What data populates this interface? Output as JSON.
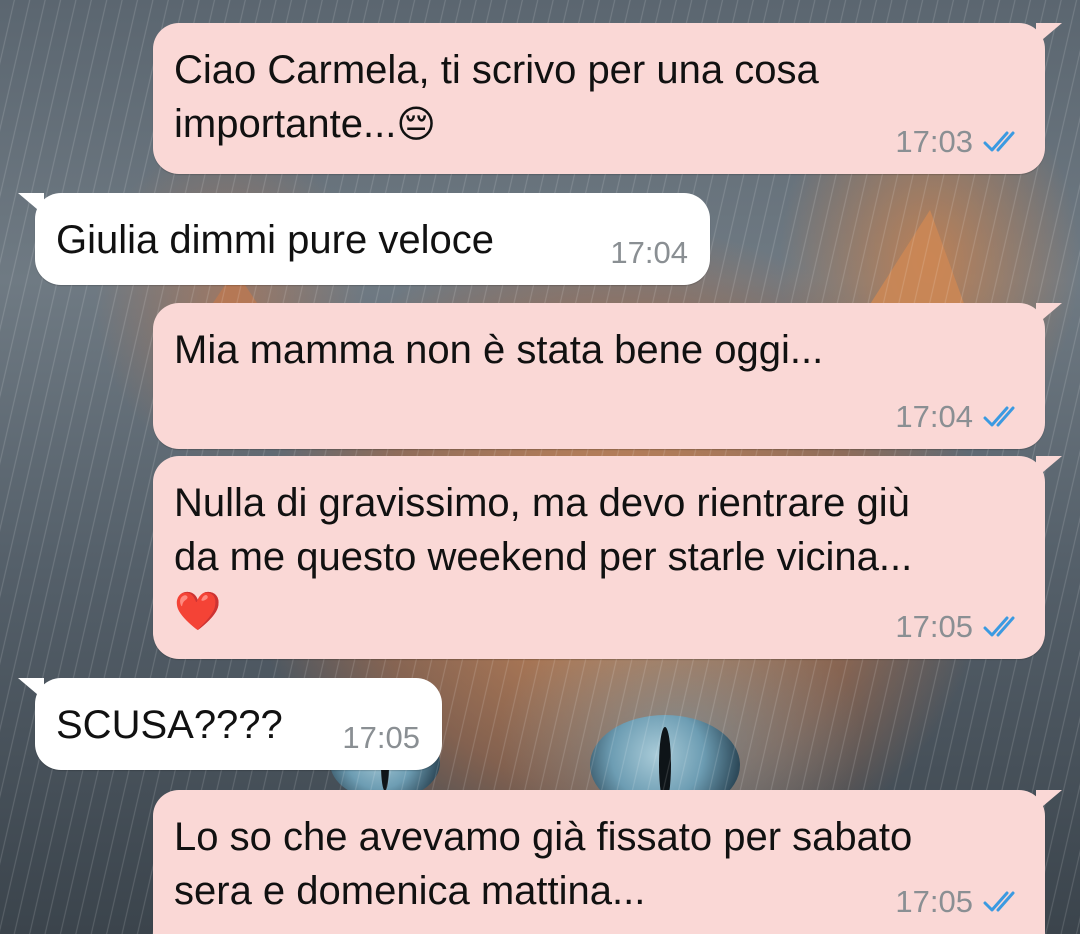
{
  "colors": {
    "outgoing_bubble": "#fad8d6",
    "incoming_bubble": "#ffffff",
    "read_ticks": "#3b9ae1",
    "timestamp": "#8a8f93"
  },
  "messages": [
    {
      "direction": "out",
      "text": "Ciao Carmela, ti scrivo per una cosa\nimportante...",
      "emoji": "😔",
      "time": "17:03",
      "status_icon": "double-check-read-icon"
    },
    {
      "direction": "in",
      "text": "Giulia dimmi pure veloce",
      "time": "17:04"
    },
    {
      "direction": "out",
      "text": "Mia mamma non è stata bene oggi...",
      "time": "17:04",
      "status_icon": "double-check-read-icon"
    },
    {
      "direction": "out",
      "text": "Nulla di gravissimo, ma devo rientrare giù\nda me questo weekend per starle vicina...",
      "emoji": "❤️",
      "time": "17:05",
      "status_icon": "double-check-read-icon"
    },
    {
      "direction": "in",
      "text": "SCUSA????",
      "time": "17:05"
    },
    {
      "direction": "out",
      "text": "Lo so che avevamo già fissato per sabato\nsera e domenica mattina...",
      "time": "17:05",
      "status_icon": "double-check-read-icon"
    }
  ]
}
